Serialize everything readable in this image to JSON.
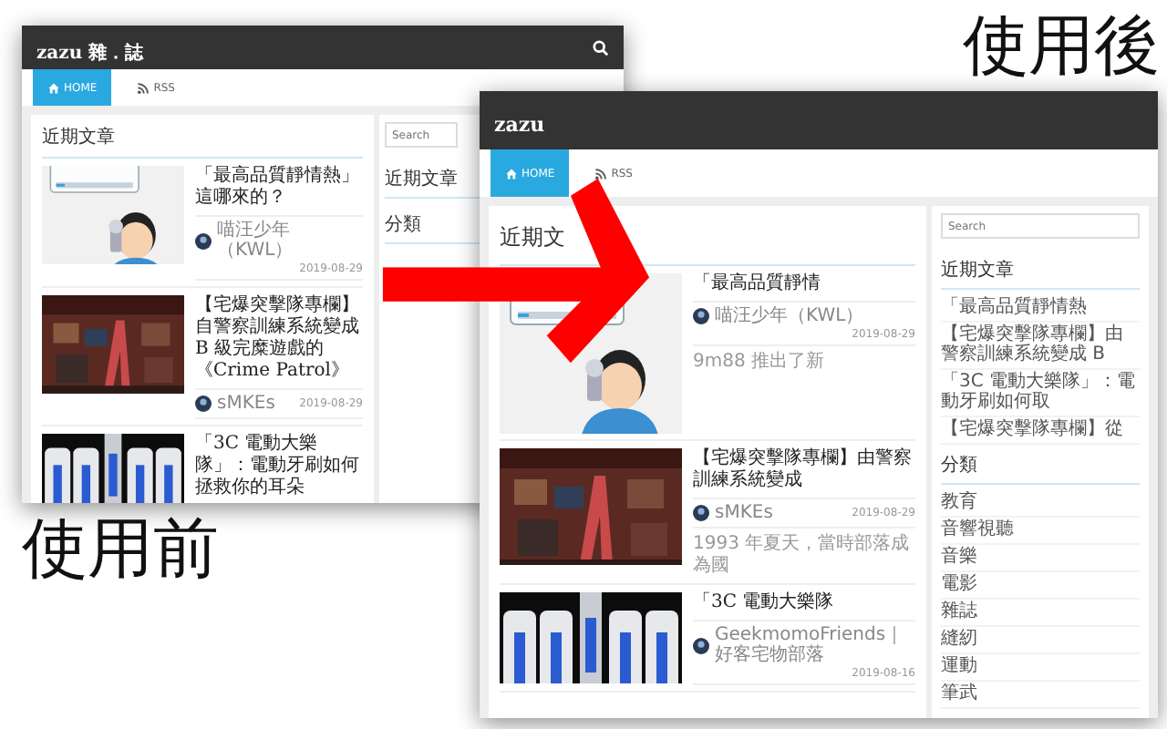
{
  "captions": [
    {
      "kind": "after",
      "text": "使用後"
    },
    {
      "kind": "before",
      "text": "使用前"
    }
  ],
  "screens": [
    {
      "kind": "before",
      "site_title": "zazu 雜．誌",
      "nav": [
        {
          "label": "HOME",
          "selected": true
        },
        {
          "label": "RSS",
          "selected": false
        }
      ],
      "section_title": "近期文章",
      "posts": [
        {
          "title": "「最高品質靜情熱」這哪來的？",
          "author": "喵汪少年（KWL）",
          "date": "2019-08-29"
        },
        {
          "title": "【宅爆突擊隊專欄】自警察訓練系統變成 B 級完糜遊戲的《Crime Patrol》",
          "author": "sMKEs",
          "date": "2019-08-29"
        },
        {
          "title": "「3C 電動大樂隊」：電動牙刷如何拯救你的耳朵"
        }
      ],
      "sidebar": {
        "search_placeholder": "Search",
        "widgets": [
          {
            "title": "近期文章"
          },
          {
            "title": "分類"
          }
        ]
      }
    },
    {
      "kind": "after",
      "site_title": "zazu",
      "nav": [
        {
          "label": "HOME",
          "selected": true
        },
        {
          "label": "RSS",
          "selected": false
        }
      ],
      "section_title": "近期文",
      "posts": [
        {
          "title": "「最高品質靜情",
          "author": "喵汪少年（KWL）",
          "date": "2019-08-29",
          "excerpt": "9m88 推出了新"
        },
        {
          "title": "【宅爆突擊隊專欄】由警察訓練系統變成",
          "author": "sMKEs",
          "date": "2019-08-29",
          "excerpt": "1993 年夏天，當時部落成為國"
        },
        {
          "title": "「3C 電動大樂隊",
          "author": "GeekmomoFriends｜好客宅物部落",
          "date": "2019-08-16"
        }
      ],
      "sidebar": {
        "search_placeholder": "Search",
        "widgets": [
          {
            "title": "近期文章",
            "items": [
              "「最高品質靜情熱",
              "【宅爆突擊隊專欄】由警察訓練系統變成 B",
              "「3C 電動大樂隊」：電動牙刷如何取",
              "【宅爆突擊隊專欄】從"
            ]
          },
          {
            "title": "分類",
            "items": [
              "教育",
              "音響視聽",
              "音樂",
              "電影",
              "雜誌",
              "縫紉",
              "運動",
              "筆武"
            ]
          }
        ]
      }
    }
  ]
}
